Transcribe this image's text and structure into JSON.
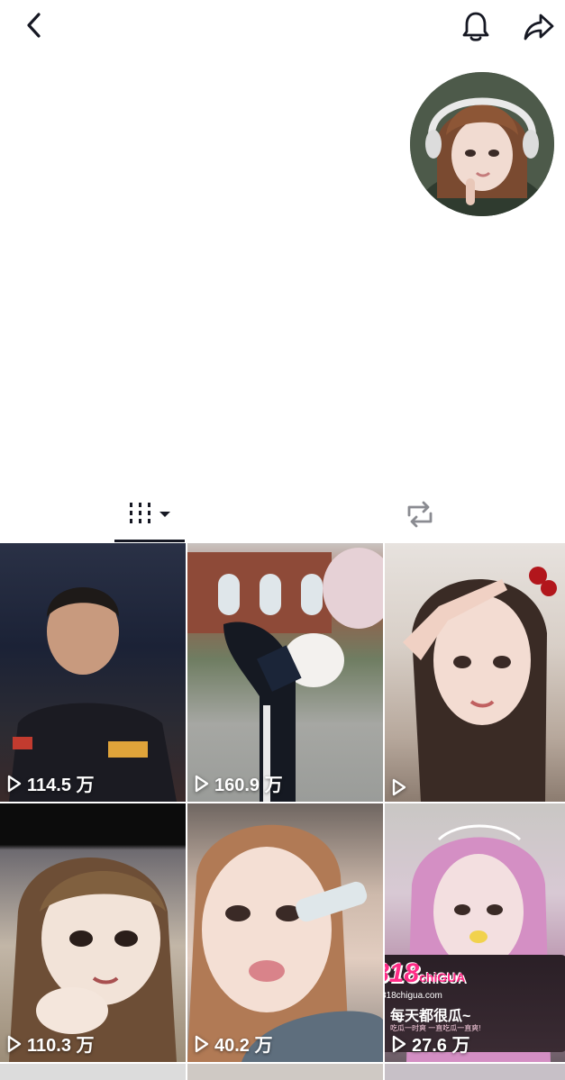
{
  "colors": {
    "icon": "#161823",
    "tab_underline": "#161823",
    "tab_inactive": "#8a8b91",
    "overlay_text": "#ffffff",
    "ad_accent": "#ff2b86"
  },
  "header": {
    "back_icon": "chevron-left-icon",
    "notification_icon": "bell-icon",
    "share_icon": "share-icon"
  },
  "tabs": [
    {
      "icon": "grid-icon",
      "selected": true
    },
    {
      "icon": "repost-icon",
      "selected": false
    }
  ],
  "videos": [
    {
      "views": "114.5 万"
    },
    {
      "views": "160.9 万"
    },
    {
      "views": ""
    },
    {
      "views": "110.3 万"
    },
    {
      "views": "40.2 万"
    },
    {
      "views": "27.6 万"
    }
  ],
  "ad": {
    "logo": "818",
    "logo_suffix": "chiGUA",
    "url": "818chigua.com",
    "slogan": "每天都很瓜~",
    "subline": "吃瓜一时爽 一直吃瓜一直爽!"
  }
}
